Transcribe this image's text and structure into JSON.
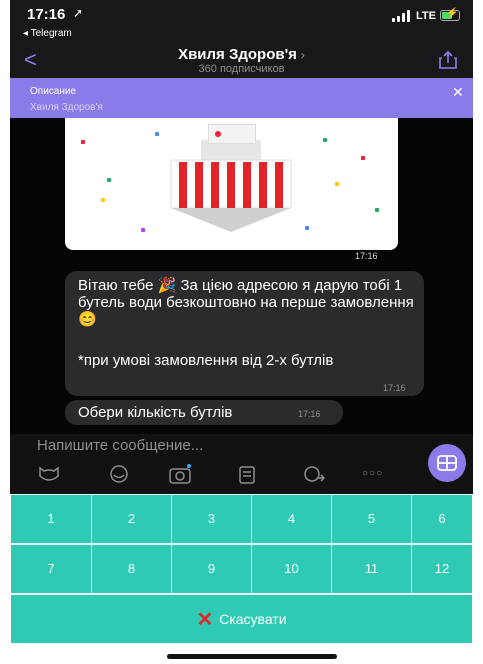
{
  "status": {
    "time": "17:16",
    "back_app": "◂ Telegram",
    "network": "LTE"
  },
  "nav": {
    "title": "Хвиля Здоров'я",
    "chevron": "›",
    "subtitle": "360 подписчиков"
  },
  "description": {
    "title": "Описание",
    "text": "Хвиля Здоров'я"
  },
  "messages": [
    {
      "type": "image",
      "time": "17:16"
    },
    {
      "type": "text",
      "text": "Вітаю тебе 🎉 За цією адресою я дарую тобі 1 бутель води безкоштовно на перше замовлення 😊",
      "note": "*при умові замовлення від 2-х бутлів",
      "time": "17:16"
    },
    {
      "type": "text",
      "text": "Обери кількість бутлів",
      "time": "17:16"
    }
  ],
  "input": {
    "placeholder": "Напишите сообщение..."
  },
  "keyboard": {
    "row1": [
      "1",
      "2",
      "3",
      "4",
      "5",
      "6"
    ],
    "row2": [
      "7",
      "8",
      "9",
      "10",
      "11",
      "12"
    ],
    "cancel_label": "Скасувати"
  },
  "icons": [
    "location-arrow-icon",
    "signal-icon",
    "battery-icon",
    "back-chevron-icon",
    "share-icon",
    "close-icon",
    "sticker-icon",
    "emoji-icon",
    "camera-icon",
    "attachment-icon",
    "share-location-icon",
    "more-icon",
    "keyboard-grid-icon",
    "cancel-x-icon"
  ],
  "colors": {
    "accent": "#8a7ce8",
    "keyboard": "#2ecab3",
    "cancel_x": "#e0262d",
    "bubble": "#2b2b2d"
  }
}
